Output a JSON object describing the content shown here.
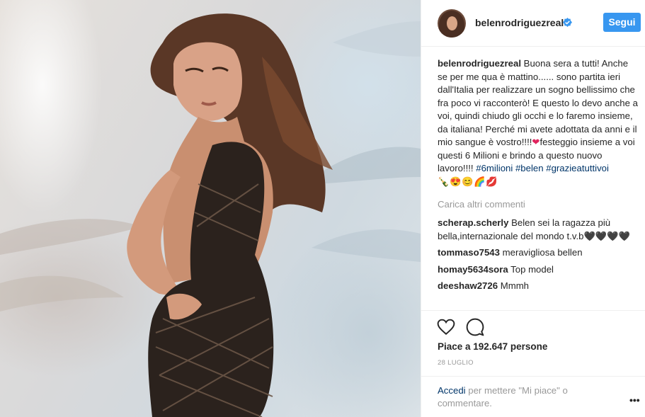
{
  "post": {
    "username": "belenrodriguezreal",
    "follow_label": "Segui",
    "caption": {
      "username": "belenrodriguezreal",
      "text": "Buona sera a tutti! Anche se per me qua è mattino...... sono partita ieri dall'Italia per realizzare un sogno bellissimo che fra poco vi racconterò! E questo lo devo anche a voi, quindi chiudo gli occhi e lo faremo insieme, da italiana! Perché mi avete adottata da anni e il mio sangue è vostro!!!!",
      "heart": "❤",
      "text2": "festeggio insieme a voi questi 6 Milioni e brindo a questo nuovo lavoro!!!! ",
      "hashtags": [
        "#6milioni",
        "#belen",
        "#grazieatuttivoi"
      ],
      "emojis": [
        "🍾",
        "😍",
        "😊",
        "🌈",
        "💋"
      ]
    },
    "load_more": "Carica altri commenti",
    "comments": [
      {
        "username": "scherap.scherly",
        "text": "Belen sei la ragazza più bella,internazionale del mondo t.v.b🖤🖤🖤🖤"
      },
      {
        "username": "tommaso7543",
        "text": "meravigliosa bellen"
      },
      {
        "username": "homay5634sora",
        "text": "Top model"
      },
      {
        "username": "deeshaw2726",
        "text": "Mmmh"
      }
    ],
    "likes": "Piace a 192.647 persone",
    "date": "28 LUGLIO",
    "login_prompt": {
      "link": "Accedi",
      "text": " per mettere \"Mi piace\" o commentare."
    },
    "more_label": "•••"
  },
  "icons": {
    "like": "heart-outline-icon",
    "comment": "speech-bubble-icon",
    "verified": "verified-badge-icon"
  },
  "colors": {
    "accent": "#3897f0",
    "link": "#003569",
    "muted": "#999999"
  }
}
